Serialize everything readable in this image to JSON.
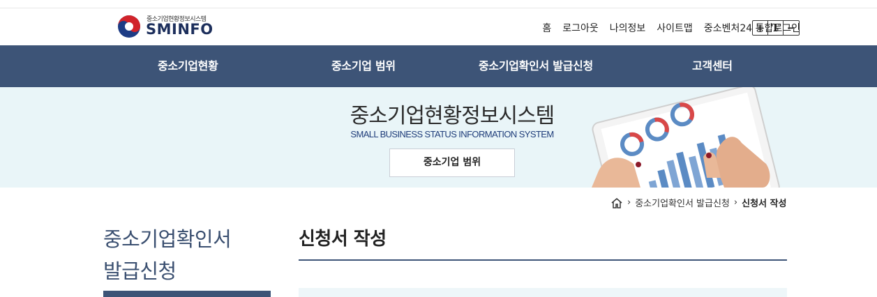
{
  "header": {
    "logo_sub": "중소기업현황정보시스템",
    "logo_main": "SMINFO",
    "util_links": [
      "홈",
      "로그아웃",
      "나의정보",
      "사이트맵",
      "중소벤처24 통합로그인"
    ],
    "font_controls": [
      "+",
      "T",
      "−"
    ]
  },
  "gnb": {
    "items": [
      "중소기업현황",
      "중소기업 범위",
      "중소기업확인서 발급신청",
      "고객센터"
    ]
  },
  "hero": {
    "title": "중소기업현황정보시스템",
    "subtitle": "SMALL BUSINESS STATUS INFORMATION SYSTEM",
    "button": "중소기업 범위"
  },
  "breadcrumb": {
    "items": [
      "중소기업확인서 발급신청",
      "신청서 작성"
    ]
  },
  "lnb": {
    "title_line1": "중소기업확인서",
    "title_line2": "발급신청"
  },
  "main": {
    "title": "신청서 작성"
  },
  "colors": {
    "nav_bg": "#3d5477",
    "hero_bg": "#e9f5f8",
    "logo_text": "#1d2f5c",
    "subtitle_text": "#1f3d7a"
  }
}
